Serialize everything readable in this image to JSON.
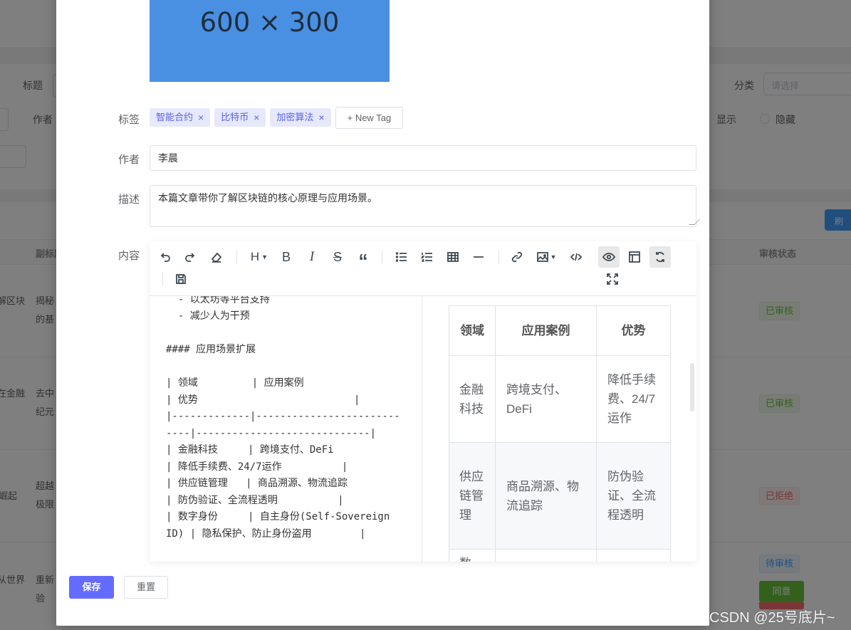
{
  "background": {
    "filter_labels": {
      "title": "标题",
      "category": "分类",
      "author": "作者",
      "show": "显示",
      "hide": "隐藏"
    },
    "category_placeholder": "请选择",
    "table_headers": {
      "subtitle": "副标题",
      "review_status": "审核状态"
    },
    "rows": [
      {
        "title_frag": "解区块",
        "subtitle_frag": [
          "揭秘",
          "的基"
        ],
        "status": "已审核"
      },
      {
        "title_frag": "在金融",
        "subtitle_frag": [
          "去中",
          "纪元"
        ],
        "status": "已审核"
      },
      {
        "title_frag": "崛起",
        "subtitle_frag": [
          "超越",
          "极限"
        ],
        "status": "已拒绝"
      },
      {
        "title_frag": "从世界",
        "subtitle_frag": [
          "重新",
          "验"
        ],
        "status": "待审核"
      }
    ],
    "approve_label": "同意",
    "refresh_label": "刷"
  },
  "dialog": {
    "cover_text": "600 × 300",
    "labels": {
      "tags": "标签",
      "author": "作者",
      "description": "描述",
      "content": "内容"
    },
    "tags": [
      "智能合约",
      "比特币",
      "加密算法"
    ],
    "tag_close": "×",
    "new_tag_label": "+ New Tag",
    "author_value": "李晨",
    "description_value": "本篇文章带你了解区块链的核心原理与应用场景。",
    "editor": {
      "toolbar_icons": [
        "undo-icon",
        "redo-icon",
        "eraser-icon",
        "heading-icon",
        "bold-icon",
        "italic-icon",
        "strikethrough-icon",
        "quote-icon",
        "unordered-list-icon",
        "ordered-list-icon",
        "table-icon",
        "horizontal-rule-icon",
        "link-icon",
        "image-icon",
        "code-icon",
        "preview-icon",
        "html-preview-icon",
        "sync-scroll-icon",
        "save-icon",
        "fullscreen-icon"
      ],
      "toolbar_glyphs": {
        "heading": "H",
        "bold": "B",
        "italic": "I",
        "strike": "S",
        "quote": "“"
      },
      "source_lines": [
        "  - 以太坊等平台支持",
        "  - 减少人为干预",
        "",
        "#### 应用场景扩展",
        "",
        "| 领域         | 应用案例",
        "| 优势                          |",
        "|-------------|------------------------",
        "----|-----------------------------|",
        "| 金融科技     | 跨境支付、DeFi",
        "| 降低手续费、24/7运作          |",
        "| 供应链管理   | 商品溯源、物流追踪",
        "| 防伪验证、全流程透明          |",
        "| 数字身份     | 自主身份(Self-Sovereign",
        "ID) | 隐私保护、防止身份盗用        |"
      ],
      "preview_table": {
        "headers": [
          "领域",
          "应用案例",
          "优势"
        ],
        "rows": [
          [
            "金融科技",
            "跨境支付、DeFi",
            "降低手续费、24/7运作"
          ],
          [
            "供应链管理",
            "商品溯源、物流追踪",
            "防伪验证、全流程透明"
          ],
          [
            "数",
            "",
            ""
          ]
        ]
      }
    },
    "save_label": "保存",
    "reset_label": "重置"
  },
  "watermark": "CSDN @25号底片~"
}
